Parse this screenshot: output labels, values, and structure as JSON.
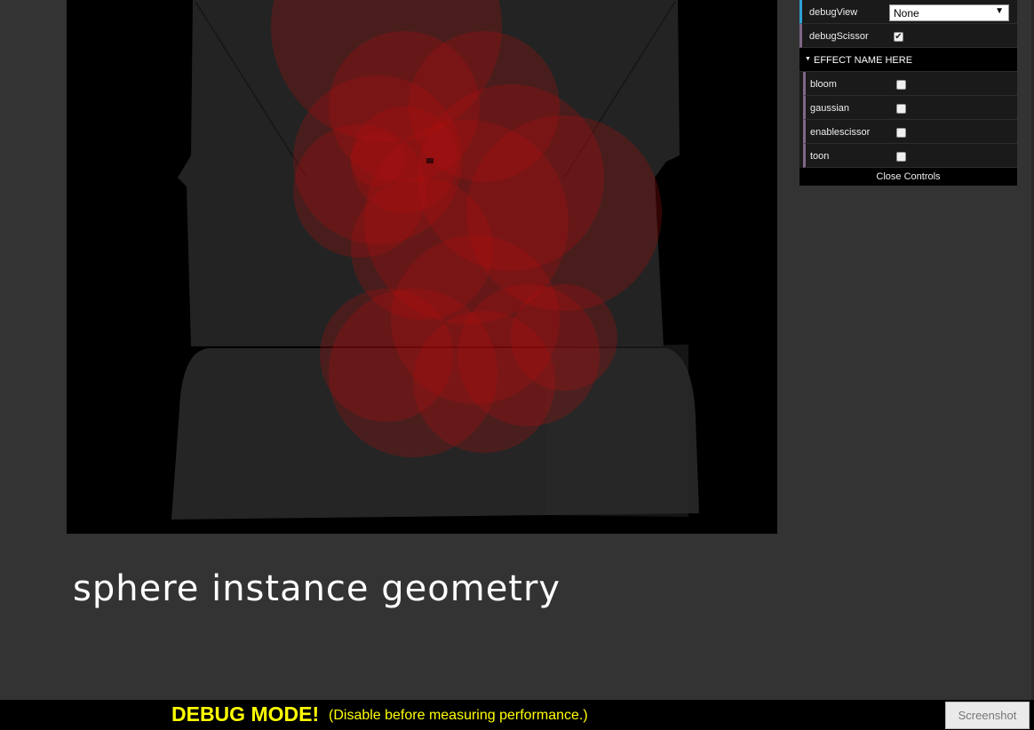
{
  "caption": "sphere instance geometry",
  "gui": {
    "debugView": {
      "label": "debugView",
      "value": "None",
      "arrow": "▼"
    },
    "debugScissor": {
      "label": "debugScissor",
      "checked": true,
      "check_glyph": "✔"
    },
    "folder": {
      "title": "EFFECT NAME HERE",
      "items": [
        {
          "label": "bloom",
          "checked": false
        },
        {
          "label": "gaussian",
          "checked": false
        },
        {
          "label": "enablescissor",
          "checked": false
        },
        {
          "label": "toon",
          "checked": false
        }
      ]
    },
    "close_label": "Close Controls"
  },
  "debug": {
    "title": "DEBUG MODE!",
    "note": "(Disable before measuring performance.)"
  },
  "screenshot_label": "Screenshot",
  "colors": {
    "background": "#333333",
    "viewport": "#000000",
    "spheres": "#b01010",
    "debug_text": "#ffff00",
    "accent_blue": "#2fa1d6",
    "accent_purple": "#806787"
  }
}
